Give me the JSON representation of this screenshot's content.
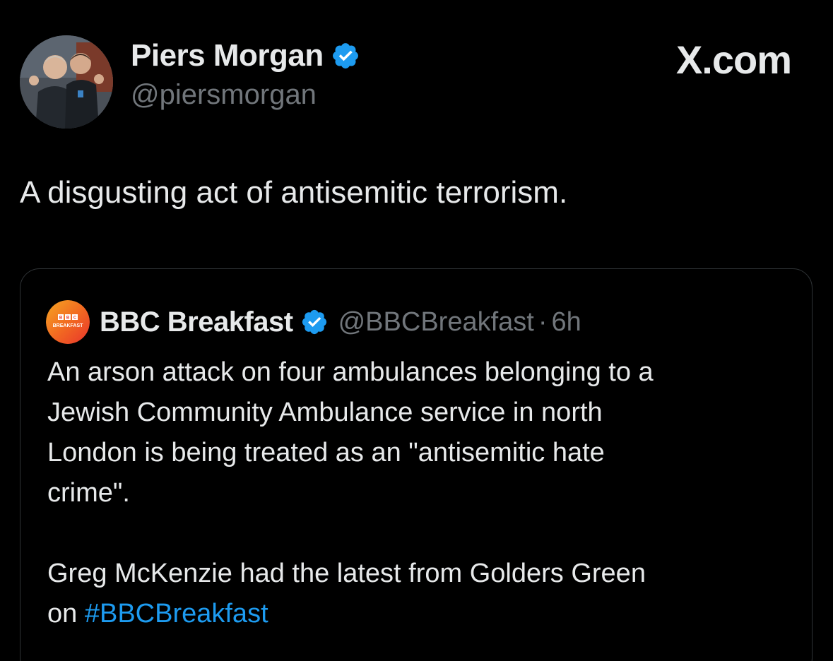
{
  "author": {
    "name": "Piers Morgan",
    "handle": "@piersmorgan",
    "verified_icon": "verified-badge-icon"
  },
  "brand": {
    "label": "X.com"
  },
  "tweet": {
    "text": "A disgusting act of antisemitic terrorism."
  },
  "quoted_tweet": {
    "name": "BBC Breakfast",
    "handle": "@BBCBreakfast",
    "separator": "·",
    "time": "6h",
    "avatar_text_top": "BBC",
    "avatar_text_bottom": "BREAKFAST",
    "lines": [
      "An arson attack on four ambulances belonging to a",
      "Jewish Community Ambulance service in north",
      "London is being treated as an \"antisemitic hate",
      "crime\"."
    ],
    "para2_prefix": "Greg McKenzie had the latest from Golders Green",
    "para2_line2_prefix": "on",
    "hashtag": "#BBCBreakfast"
  },
  "colors": {
    "background": "#000000",
    "text_primary": "#e7e9ea",
    "text_secondary": "#71767b",
    "accent_blue": "#1d9bf0",
    "border": "#2f3336"
  }
}
